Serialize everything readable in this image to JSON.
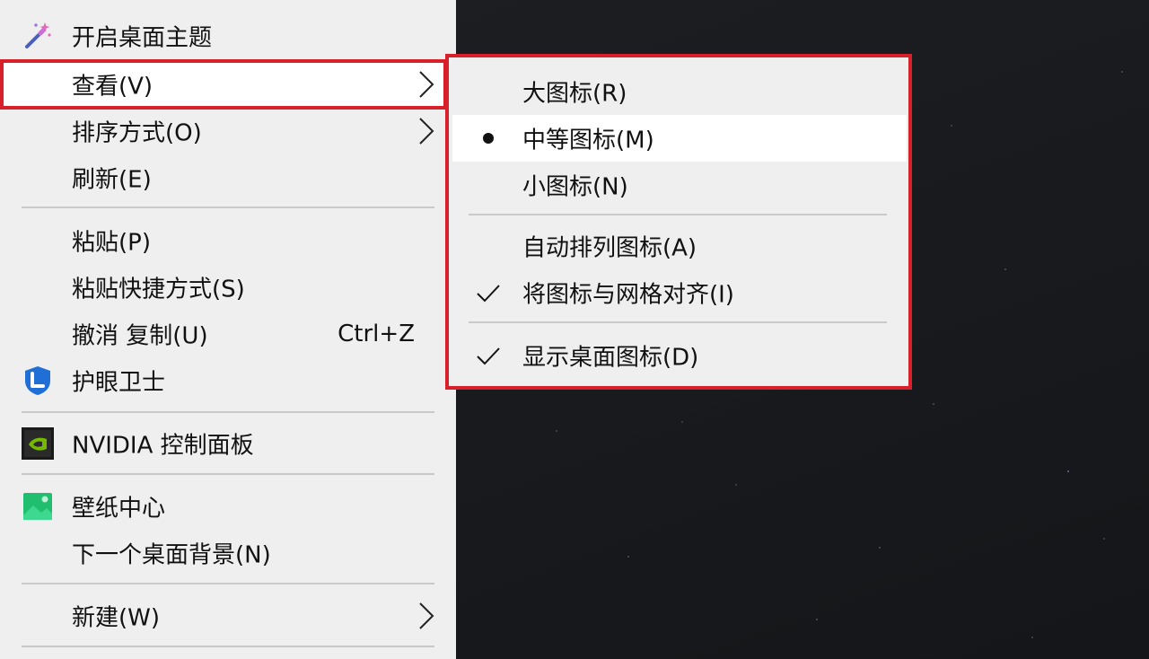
{
  "main_menu": {
    "items": [
      {
        "label": "开启桌面主题",
        "icon": "magic-wand-icon"
      },
      {
        "label": "查看(V)",
        "has_submenu": true,
        "highlighted": true
      },
      {
        "label": "排序方式(O)",
        "has_submenu": true
      },
      {
        "label": "刷新(E)"
      },
      {
        "label": "粘贴(P)"
      },
      {
        "label": "粘贴快捷方式(S)"
      },
      {
        "label": "撤消 复制(U)",
        "shortcut": "Ctrl+Z"
      },
      {
        "label": "护眼卫士",
        "icon": "eye-guard-shield-icon"
      },
      {
        "label": "NVIDIA 控制面板",
        "icon": "nvidia-icon"
      },
      {
        "label": "壁纸中心",
        "icon": "wallpaper-center-icon"
      },
      {
        "label": "下一个桌面背景(N)"
      },
      {
        "label": "新建(W)",
        "has_submenu": true
      }
    ]
  },
  "view_submenu": {
    "items": [
      {
        "label": "大图标(R)",
        "mark": "none"
      },
      {
        "label": "中等图标(M)",
        "mark": "bullet",
        "hovered": true
      },
      {
        "label": "小图标(N)",
        "mark": "none"
      },
      {
        "label": "自动排列图标(A)",
        "mark": "none"
      },
      {
        "label": "将图标与网格对齐(I)",
        "mark": "check"
      },
      {
        "label": "显示桌面图标(D)",
        "mark": "check"
      }
    ]
  },
  "colors": {
    "menu_bg": "#efefef",
    "highlight_border": "#d8202a",
    "desktop_bg": "#16181c"
  }
}
